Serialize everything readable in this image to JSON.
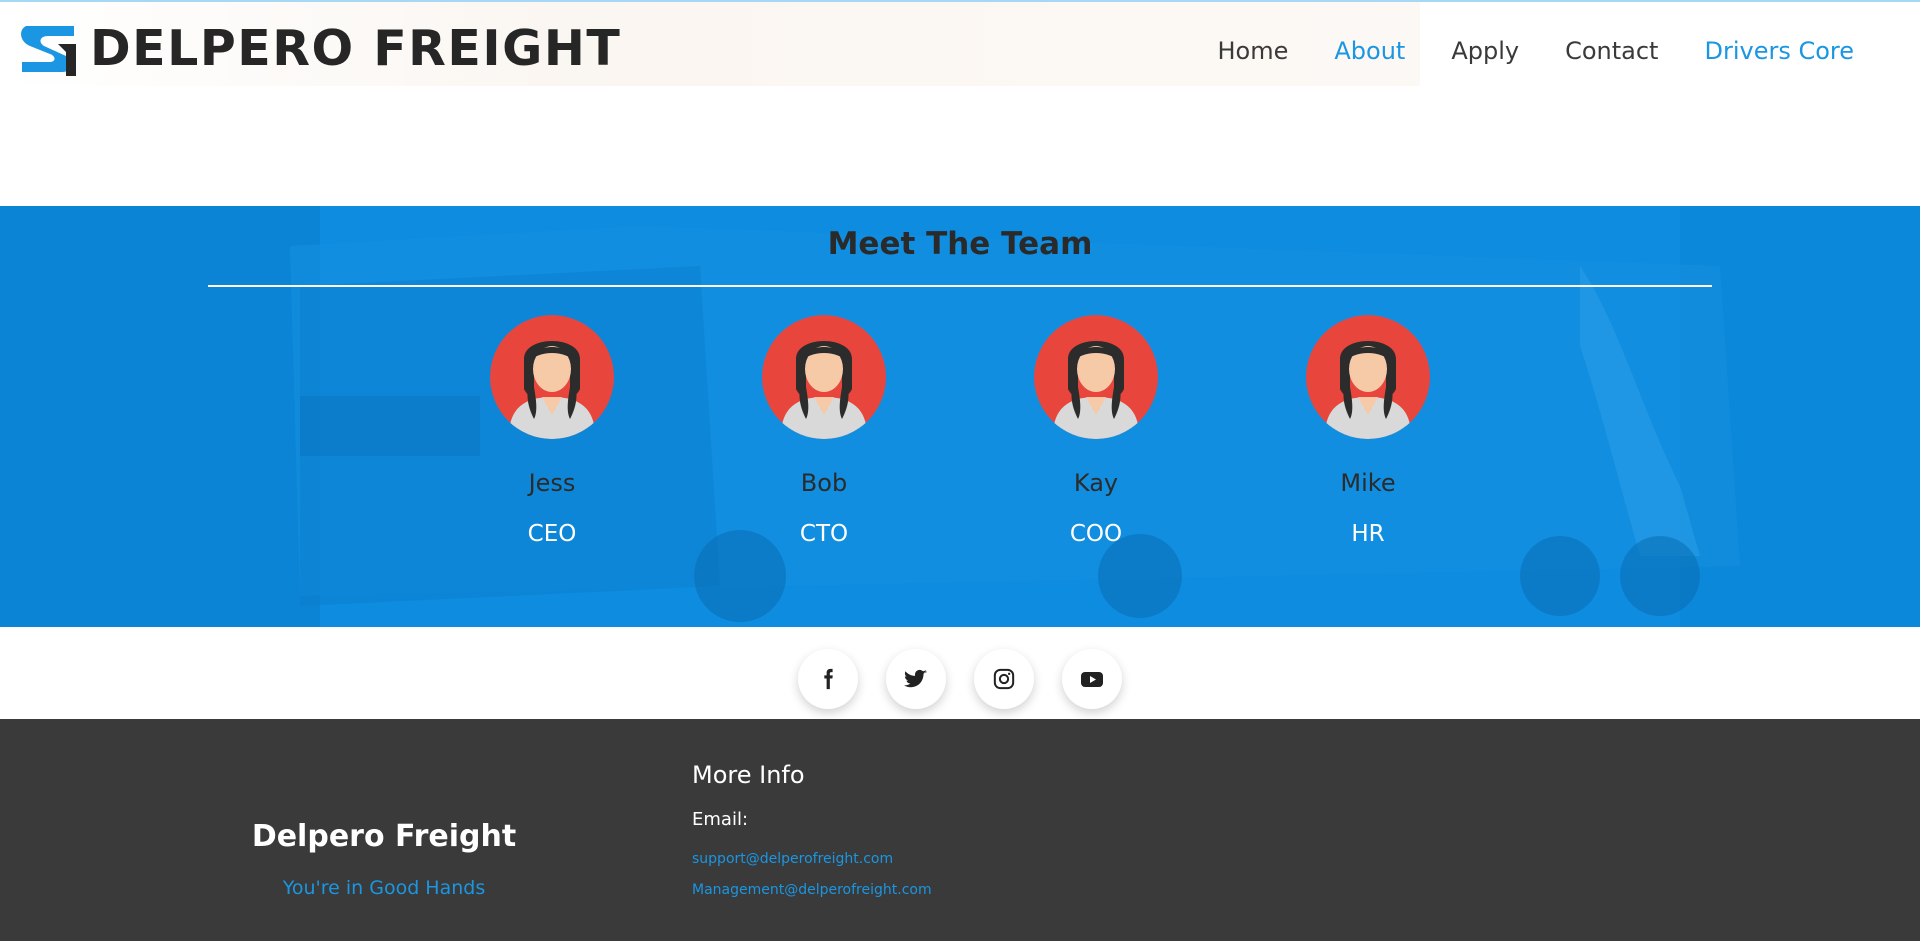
{
  "brand": {
    "logo_text": "DELPERO FREIGHT"
  },
  "nav": {
    "items": [
      {
        "label": "Home",
        "active": false
      },
      {
        "label": "About",
        "active": true
      },
      {
        "label": "Apply",
        "active": false
      },
      {
        "label": "Contact",
        "active": false
      },
      {
        "label": "Drivers Core",
        "active": true
      }
    ]
  },
  "team": {
    "title": "Meet The Team",
    "members": [
      {
        "name": "Jess",
        "role": "CEO",
        "icon": "female-avatar-icon"
      },
      {
        "name": "Bob",
        "role": "CTO",
        "icon": "female-avatar-icon"
      },
      {
        "name": "Kay",
        "role": "COO",
        "icon": "female-avatar-icon"
      },
      {
        "name": "Mike",
        "role": "HR",
        "icon": "female-avatar-icon"
      }
    ]
  },
  "social": {
    "icons": [
      "facebook-icon",
      "twitter-icon",
      "instagram-icon",
      "youtube-icon"
    ]
  },
  "footer": {
    "brand_name": "Delpero Freight",
    "tagline": "You're in Good Hands",
    "more_info_title": "More Info",
    "email_label": "Email:",
    "emails": [
      "support@delperofreight.com",
      "Management@delperofreight.com"
    ]
  },
  "colors": {
    "accent": "#1a96e2",
    "team_bg": "#0d8ce0",
    "footer_bg": "#3a3a3a",
    "avatar_bg": "#e8463d"
  }
}
